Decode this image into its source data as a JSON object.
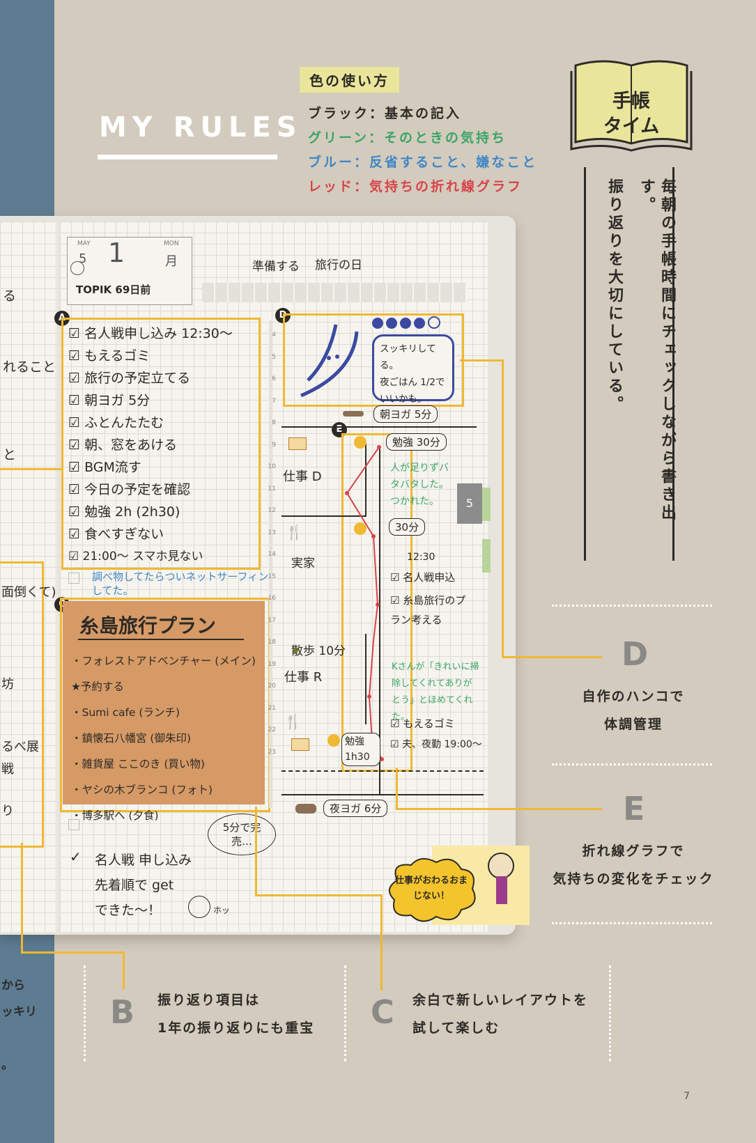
{
  "header": {
    "title": "MY RULES"
  },
  "legend": {
    "heading": "色の使い方",
    "items": [
      {
        "label": "ブラック：基本の記入",
        "color": "#2d2a26"
      },
      {
        "label": "グリーン：そのときの気持ち",
        "color": "#3aa568"
      },
      {
        "label": "ブルー：反省すること、嫌なこと",
        "color": "#3f86c6"
      },
      {
        "label": "レッド：気持ちの折れ線グラフ",
        "color": "#d8434a"
      }
    ]
  },
  "badge": {
    "line1": "手帳",
    "line2": "タイム"
  },
  "vertical": {
    "line1": "毎朝の手帳時間にチェックしながら書き出す。",
    "line2": "振り返りを大切にしている。"
  },
  "notebook": {
    "left_fragments": [
      "る",
      "れること",
      "と",
      "面倒くて)",
      "坊",
      "るべ展",
      "戦",
      "り"
    ],
    "date": {
      "month_label": "MAY",
      "month": "5",
      "day": "1",
      "dow_label": "MON",
      "dow": "月",
      "memo": "TOPIK 69日前"
    },
    "labels": {
      "a": "A",
      "c": "C",
      "d": "D",
      "e": "E"
    },
    "checklist": [
      "名人戦申し込み 12:30～",
      "もえるゴミ",
      "旅行の予定立てる",
      "朝ヨガ 5分",
      "ふとんたたむ",
      "朝、窓をあける",
      "BGM流す",
      "今日の予定を確認",
      "勉強 2h (2h30)",
      "食べすぎない",
      "21:00～ スマホ見ない"
    ],
    "blue_note": "調べ物してたらついネットサーフィンしてた。",
    "plan": {
      "title": "糸島旅行プラン",
      "items": [
        "・フォレストアドベンチャー (メイン) ★予約する",
        "・Sumi cafe (ランチ)",
        "・鎮懐石八幡宮 (御朱印)",
        "・雑貨屋 ここのき (買い物)",
        "・ヤシの木ブランコ (フォト)",
        "・博多駅へ (夕食)"
      ]
    },
    "bubble": "5分で完売…",
    "bottom_notes": [
      "名人戦 申し込み",
      "先着順で get",
      "できた～！"
    ],
    "hoc": "ホッ",
    "timeline": {
      "top1": "準備する",
      "top2": "旅行の日",
      "stamp_text": [
        "スッキリしてる。",
        "夜ごはん 1/2で",
        "いいかも。"
      ],
      "entries": [
        "朝ヨガ 5分",
        "勉強 30分",
        "仕事 D",
        "人が足りずバタバタした。つかれた。",
        "30分",
        "実家",
        "12:30",
        "名人戦申込",
        "糸島旅行のプラン考える",
        "散歩 10分",
        "仕事 R",
        "Kさんが「きれいに掃除してくれてありがとう」とほめてくれた。",
        "もえるゴミ",
        "夫、夜勤 19:00～",
        "勉強 1h30",
        "夜ヨガ 6分"
      ],
      "hours": [
        "4",
        "5",
        "6",
        "7",
        "8",
        "9",
        "10",
        "11",
        "12",
        "13",
        "14",
        "15",
        "16",
        "17",
        "18",
        "19",
        "20",
        "21",
        "22",
        "23"
      ]
    },
    "tab": "5",
    "sticky": "仕事がおわるおまじない！"
  },
  "annotations": {
    "b": {
      "letter": "B",
      "line1": "振り返り項目は",
      "line2": "1年の振り返りにも重宝"
    },
    "c": {
      "letter": "C",
      "line1": "余白で新しいレイアウトを",
      "line2": "試して楽しむ"
    },
    "d": {
      "letter": "D",
      "line1": "自作のハンコで",
      "line2": "体調管理"
    },
    "e": {
      "letter": "E",
      "line1": "折れ線グラフで",
      "line2": "気持ちの変化をチェック"
    }
  },
  "left_cut": [
    "から",
    "ッキリ",
    "。"
  ],
  "page_number": "7"
}
